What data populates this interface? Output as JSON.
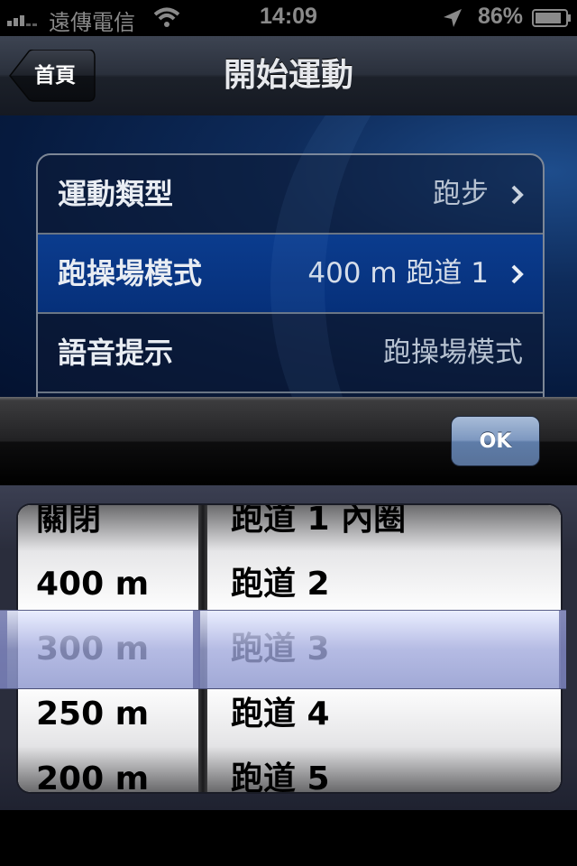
{
  "status_bar": {
    "carrier": "遠傳電信",
    "time": "14:09",
    "battery": "86%",
    "icons": [
      "signal-icon",
      "wifi-icon",
      "location-icon",
      "battery-icon"
    ]
  },
  "nav": {
    "back_label": "首頁",
    "title": "開始運動"
  },
  "settings": {
    "rows": [
      {
        "label": "運動類型",
        "value": "跑步"
      },
      {
        "label": "跑操場模式",
        "value": "400 m 跑道 1"
      },
      {
        "label": "語音提示",
        "value": "跑操場模式"
      }
    ]
  },
  "toolbar": {
    "ok_label": "OK"
  },
  "picker": {
    "left_items": [
      "關閉",
      "400 m",
      "300 m",
      "250 m",
      "200 m"
    ],
    "right_items": [
      "跑道 1 內圈",
      "跑道 2",
      "跑道 3",
      "跑道 4",
      "跑道 5"
    ],
    "selected_left": "300 m",
    "selected_right": "跑道 3"
  },
  "colors": {
    "selected_row": "#06307a",
    "ok_button": "#7d98c0",
    "selection_bar": "#a0a8dc"
  }
}
